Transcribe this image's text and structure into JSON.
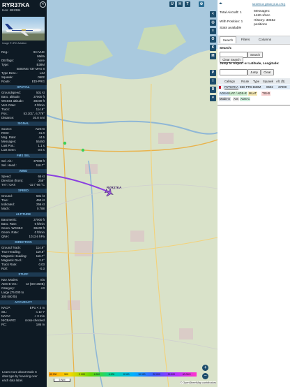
{
  "sidebar": {
    "callsign": "RYR37KA",
    "hex_line": "Hex: 4B2384",
    "close_glyph": "✕",
    "photo_caption": "Image © JRC Aviation",
    "details": [
      {
        "label": "Reg.:",
        "value": "9H-VUE"
      },
      {
        "label": "",
        "value": "Malta"
      },
      {
        "label": "DB flags:",
        "value": "none"
      },
      {
        "label": "Type:",
        "value": "B38M"
      },
      {
        "label": "",
        "value": "BOEING 737 MAX 8"
      },
      {
        "label": "Type Desc.:",
        "value": "L2J"
      },
      {
        "label": "Squawk:",
        "value": "0502"
      },
      {
        "label": "Route:",
        "value": "EDI-PRG"
      }
    ],
    "sections": [
      {
        "title": "SPATIAL",
        "rows": [
          {
            "label": "Groundspeed:",
            "value": "501 kt"
          },
          {
            "label": "Baro. altitude:",
            "value": "37000 ft"
          },
          {
            "label": "WGS84 altitude:",
            "value": "38400 ft"
          },
          {
            "label": "Vert. Rate:",
            "value": "0 ft/min"
          },
          {
            "label": "Track:",
            "value": "114.9°"
          },
          {
            "label": "Pos.:",
            "value": "53.101°, 6.779°"
          },
          {
            "label": "Distance:",
            "value": "30.8 nmi"
          }
        ]
      },
      {
        "title": "SIGNAL",
        "rows": [
          {
            "label": "Source:",
            "value": "ADS-B"
          },
          {
            "label": "RSSI:",
            "value": "-11.0"
          },
          {
            "label": "Msg. Rate:",
            "value": "44.5"
          },
          {
            "label": "Messages:",
            "value": "55450"
          },
          {
            "label": "Last Pos.:",
            "value": "1.1 s"
          },
          {
            "label": "Last Seen:",
            "value": "0.6 s"
          }
        ]
      },
      {
        "title": "FMS SEL",
        "rows": [
          {
            "label": "Sel. Alt.:",
            "value": "37008 ft"
          },
          {
            "label": "Sel. Head.:",
            "value": "116.7°"
          }
        ]
      },
      {
        "title": "WIND",
        "rows": [
          {
            "label": "Speed:",
            "value": "65 kt"
          },
          {
            "label": "Direction (from):",
            "value": "258°"
          },
          {
            "label": "TAT / OAT:",
            "value": "-32 / -56 °C"
          }
        ]
      },
      {
        "title": "SPEED",
        "rows": [
          {
            "label": "Ground:",
            "value": "501 kt"
          },
          {
            "label": "True:",
            "value": "450 kt"
          },
          {
            "label": "Indicated:",
            "value": "256 kt"
          },
          {
            "label": "Mach:",
            "value": "0.788"
          }
        ]
      },
      {
        "title": "ALTITUDE",
        "rows": [
          {
            "label": "Barometric:",
            "value": "37000 ft"
          },
          {
            "label": "Baro. Rate:",
            "value": "0 ft/min"
          },
          {
            "label": "Geom. WGS84:",
            "value": "38400 ft"
          },
          {
            "label": "Geom. Rate:",
            "value": "0 ft/min"
          },
          {
            "label": "QNH:",
            "value": "1013.6 hPa"
          }
        ]
      },
      {
        "title": "DIRECTION",
        "rows": [
          {
            "label": "Ground Track:",
            "value": "114.9°"
          },
          {
            "label": "True Heading:",
            "value": "119.8°"
          },
          {
            "label": "Magnetic Heading:",
            "value": "116.7°"
          },
          {
            "label": "Magnetic Decl.:",
            "value": "3.2°"
          },
          {
            "label": "Track Rate:",
            "value": "0.03"
          },
          {
            "label": "Roll:",
            "value": "-0.3"
          }
        ]
      },
      {
        "title": "STUFF",
        "rows": [
          {
            "label": "Nav. Modes:",
            "value": "n/a"
          },
          {
            "label": "ADS-B Ver.:",
            "value": "v2 (DO-260B)"
          },
          {
            "label": "Category:",
            "value": "A3"
          },
          {
            "label": "Large (75 000 to",
            "value": ""
          },
          {
            "label": "300 000 lb)",
            "value": ""
          }
        ]
      },
      {
        "title": "ACCURACY",
        "rows": [
          {
            "label": "NACP:",
            "value": "EPU < 3 m"
          },
          {
            "label": "SIL:",
            "value": "≤ 1e-7"
          },
          {
            "label": "NACV:",
            "value": "< 3 m/s"
          },
          {
            "label": "NICBARO:",
            "value": "cross-checked"
          },
          {
            "label": "RC:",
            "value": "186 m"
          }
        ]
      }
    ],
    "footer_note": [
      "Learn more about Mode S",
      "data type by hovering over",
      "each data label."
    ]
  },
  "map": {
    "top_buttons": [
      "U",
      "H",
      "T"
    ],
    "side_buttons": [
      "<",
      "O",
      "K",
      "M",
      "P",
      "I",
      "R"
    ],
    "aircraft_label": "RYR37KA",
    "scale_label": "5 NM",
    "scale_ticks": [
      "40 000",
      "500",
      "2 000",
      "4 000",
      "6 000",
      "8 000",
      "10 000",
      "20 000",
      "30 000",
      "40 000+"
    ],
    "altitude_key": [
      "ft"
    ],
    "zoom_in": "+",
    "zoom_out": "−",
    "attribution": "© OpenStreetMap contributors",
    "colors": {
      "track": "#8a3fe0",
      "aircraft": "#9b5ad8",
      "water": "#a9c9de"
    }
  },
  "panel": {
    "nav_glyph": "◂▸",
    "version_line": "tar1090 on github (3.14.1751)",
    "stats": [
      {
        "label": "Total Aircraft:",
        "value": "1"
      },
      {
        "label": "With Position:",
        "value": "1"
      },
      {
        "label": "Stats available",
        "value": ""
      }
    ],
    "messages_label": "Messages:",
    "messages_value": "1420.1/sec",
    "history_label": "History: 30552",
    "history_unit": "positions",
    "tabs": [
      "Search",
      "Filters",
      "Columns"
    ],
    "search_label": "Search:",
    "search_button": "Search",
    "clear_search_button": "Clear Search",
    "jump_label": "Jump to Airport or Latitude, Longitude:",
    "jump_button": "Jump",
    "clear_button": "Clear",
    "table_headers": [
      "Callsign",
      "Route",
      "Type",
      "Squawk",
      "Alt. (ft)"
    ],
    "row": {
      "callsign": "RYR37KA",
      "route": "EDI-PRG",
      "type": "B38M",
      "squawk": "0502",
      "alt": "37000"
    },
    "source_tags": [
      {
        "text": "ADS-B",
        "bg": "#cfe3f5"
      },
      {
        "text": "UAT / ADS-R",
        "bg": "#cdeed0"
      },
      {
        "text": "MLAT",
        "bg": "#f5e7b0"
      },
      {
        "text": "TIS-B",
        "bg": "#f8cfcf"
      },
      {
        "text": "Mode-S",
        "bg": "#d8dde4"
      },
      {
        "text": "AIS",
        "bg": "#e8e8e8"
      },
      {
        "text": "ADS-C",
        "bg": "#cfeedd"
      }
    ]
  }
}
